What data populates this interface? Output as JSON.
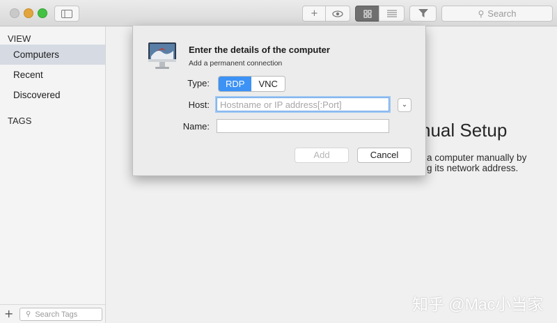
{
  "toolbar": {
    "add_icon": "plus-icon",
    "preview_icon": "eye-icon",
    "grid_icon": "grid-icon",
    "list_icon": "list-icon",
    "filter_icon": "funnel-icon",
    "search_placeholder": "Search"
  },
  "sidebar": {
    "view_header": "VIEW",
    "items": [
      {
        "label": "Computers",
        "selected": true
      },
      {
        "label": "Recent",
        "selected": false
      },
      {
        "label": "Discovered",
        "selected": false
      }
    ],
    "tags_header": "TAGS",
    "tag_search_placeholder": "Search Tags"
  },
  "main": {
    "title_fragment": "nual Setup",
    "desc_line1": "a computer manually by",
    "desc_line2": "g its network address."
  },
  "dialog": {
    "title": "Enter the details of the computer",
    "subtitle": "Add a permanent connection",
    "type_label": "Type:",
    "type_options": [
      "RDP",
      "VNC"
    ],
    "type_selected": "RDP",
    "host_label": "Host:",
    "host_placeholder": "Hostname or IP address[:Port]",
    "name_label": "Name:",
    "name_value": "",
    "add_label": "Add",
    "cancel_label": "Cancel"
  },
  "watermark": "知乎 @Mac小当家",
  "colors": {
    "accent": "#3d92f5",
    "selection": "#d6dbe3",
    "active_toolbar_button": "#6f6f6f"
  }
}
